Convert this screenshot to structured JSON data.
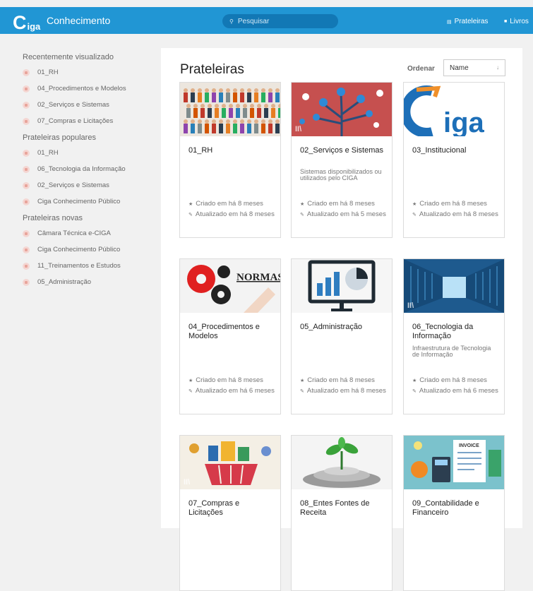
{
  "header": {
    "logo_c": "C",
    "logo_rest": "iga",
    "app_name": "Conhecimento",
    "search_placeholder": "Pesquisar",
    "nav": [
      {
        "label": "Prateleiras",
        "icon": "shelf-icon"
      },
      {
        "label": "Livros",
        "icon": "book-icon"
      }
    ]
  },
  "sidebar": {
    "sections": [
      {
        "heading": "Recentemente visualizado",
        "items": [
          "01_RH",
          "04_Procedimentos e Modelos",
          "02_Serviços e Sistemas",
          "07_Compras e Licitações"
        ]
      },
      {
        "heading": "Prateleiras populares",
        "items": [
          "01_RH",
          "06_Tecnologia da Informação",
          "02_Serviços e Sistemas",
          "Ciga Conhecimento Público"
        ]
      },
      {
        "heading": "Prateleiras novas",
        "items": [
          "Câmara Técnica e-CIGA",
          "Ciga Conhecimento Público",
          "11_Treinamentos e Estudos",
          "05_Administração"
        ]
      }
    ]
  },
  "main": {
    "title": "Prateleiras",
    "sort_label": "Ordenar",
    "sort_value": "Name",
    "sort_arrow": "↓",
    "cards": [
      {
        "title": "01_RH",
        "description": "",
        "created": "Criado em há 8 meses",
        "updated": "Atualizado em há 8 meses",
        "image": "people"
      },
      {
        "title": "02_Serviços e Sistemas",
        "description": "Sistemas disponibilizados ou utilizados pelo CIGA",
        "created": "Criado em há 8 meses",
        "updated": "Atualizado em há 5 meses",
        "image": "tree"
      },
      {
        "title": "03_Institucional",
        "description": "",
        "created": "Criado em há 8 meses",
        "updated": "Atualizado em há 8 meses",
        "image": "logo"
      },
      {
        "title": "04_Procedimentos e Modelos",
        "description": "",
        "created": "Criado em há 8 meses",
        "updated": "Atualizado em há 6 meses",
        "image": "gears"
      },
      {
        "title": "05_Administração",
        "description": "",
        "created": "Criado em há 8 meses",
        "updated": "Atualizado em há 8 meses",
        "image": "chart"
      },
      {
        "title": "06_Tecnologia da Informação",
        "description": "Infraestrutura de Tecnologia de Informação",
        "created": "Criado em há 8 meses",
        "updated": "Atualizado em há 6 meses",
        "image": "server"
      },
      {
        "title": "07_Compras e Licitações",
        "description": "",
        "created": "",
        "updated": "",
        "image": "shop"
      },
      {
        "title": "08_Entes Fontes de Receita",
        "description": "",
        "created": "",
        "updated": "",
        "image": "coins"
      },
      {
        "title": "09_Contabilidade e Financeiro",
        "description": "",
        "created": "",
        "updated": "",
        "image": "finance"
      }
    ],
    "image_text": {
      "normas": "NORMAS",
      "logo_word": "iga",
      "logo_c": "C",
      "invoice": "INVOICE"
    }
  },
  "colors": {
    "topbar": "#2196d4",
    "search": "#1278b5",
    "page_bg": "#f1f1f1"
  }
}
